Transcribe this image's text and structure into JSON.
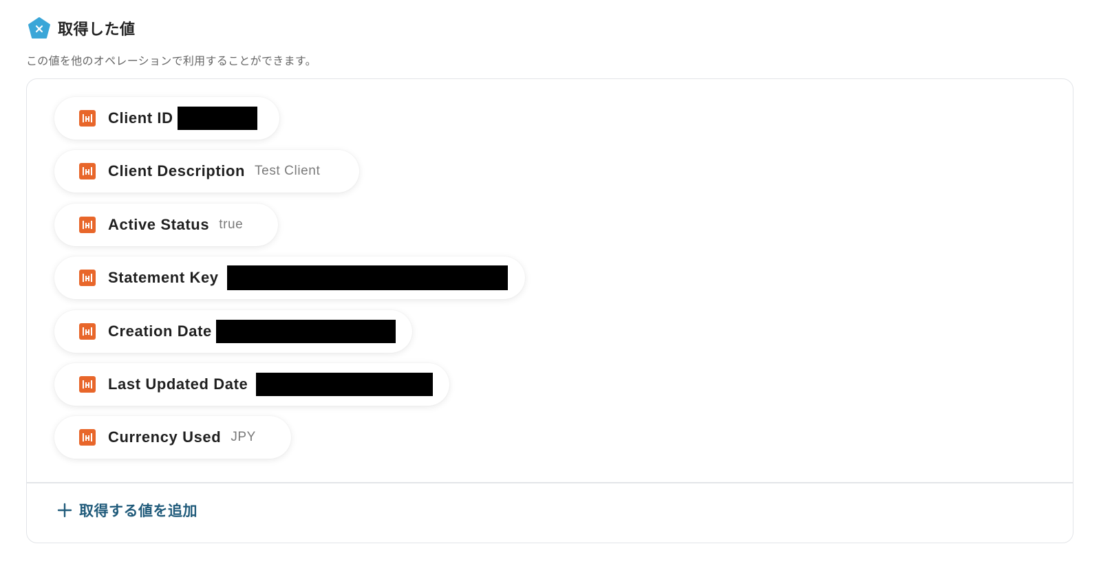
{
  "header": {
    "title": "取得した値",
    "icon": "pentagon-x-icon",
    "icon_color": "#3aa6d8"
  },
  "subtitle": "この値を他のオペレーションで利用することができます。",
  "fields": [
    {
      "label": "Client ID",
      "value": "",
      "redacted": true
    },
    {
      "label": "Client Description",
      "value": "Test Client",
      "redacted": false
    },
    {
      "label": "Active Status",
      "value": "true",
      "redacted": false
    },
    {
      "label": "Statement Key",
      "value": "",
      "redacted": true
    },
    {
      "label": "Creation Date",
      "value": "",
      "redacted": true
    },
    {
      "label": "Last Updated Date",
      "value": "",
      "redacted": true
    },
    {
      "label": "Currency Used",
      "value": "JPY",
      "redacted": false
    }
  ],
  "field_icon": "service-logo-icon",
  "field_icon_color": "#e8662a",
  "add_button": {
    "label": "取得する値を追加",
    "icon": "plus-icon",
    "color": "#1f5a7a"
  }
}
